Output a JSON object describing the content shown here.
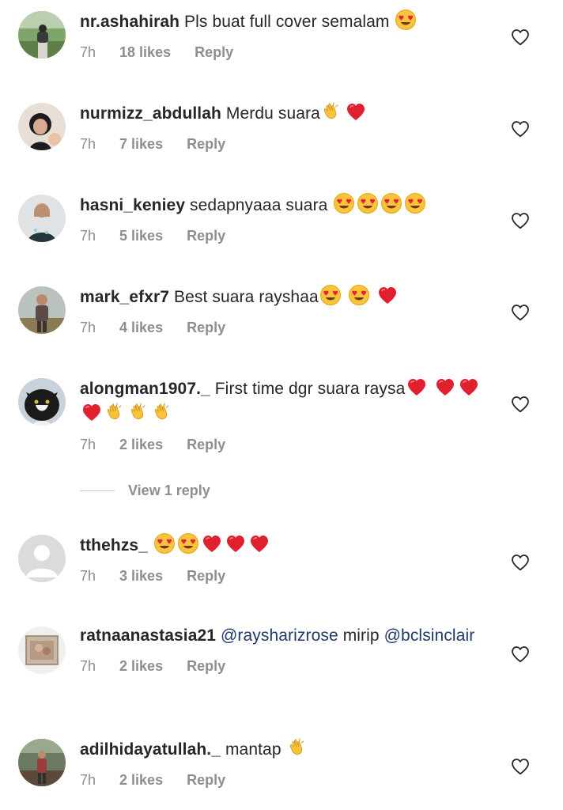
{
  "comments": [
    {
      "username": "nr.ashahirah",
      "text": "Pls buat full cover semalam",
      "time": "7h",
      "likes": "18 likes",
      "reply": "Reply",
      "emojis": [
        "heart-eyes"
      ]
    },
    {
      "username": "nurmizz_abdullah",
      "text": "Merdu suara",
      "time": "7h",
      "likes": "7 likes",
      "reply": "Reply",
      "emojis": [
        "clap",
        "red-heart"
      ]
    },
    {
      "username": "hasni_keniey",
      "text": "sedapnyaaa suara",
      "time": "7h",
      "likes": "5 likes",
      "reply": "Reply",
      "emojis": [
        "heart-eyes",
        "heart-eyes",
        "heart-eyes",
        "heart-eyes"
      ]
    },
    {
      "username": "mark_efxr7",
      "text": "Best suara rayshaa",
      "time": "7h",
      "likes": "4 likes",
      "reply": "Reply",
      "emojis": [
        "heart-eyes",
        "heart-eyes",
        "red-heart"
      ]
    },
    {
      "username": "alongman1907._",
      "text": "First time dgr suara raysa",
      "time": "7h",
      "likes": "2 likes",
      "reply": "Reply",
      "emojis": [
        "red-heart",
        "red-heart",
        "red-heart",
        "red-heart",
        "clap",
        "clap",
        "clap"
      ],
      "view_replies": "View 1 reply"
    },
    {
      "username": "tthehzs_",
      "text": "",
      "time": "7h",
      "likes": "3 likes",
      "reply": "Reply",
      "emojis": [
        "heart-eyes",
        "heart-eyes",
        "red-heart",
        "red-heart",
        "red-heart"
      ]
    },
    {
      "username": "ratnaanastasia21",
      "mention1": "@raysharizrose",
      "text": "mirip",
      "mention2": "@bclsinclair",
      "time": "7h",
      "likes": "2 likes",
      "reply": "Reply"
    },
    {
      "username": "adilhidayatullah._",
      "text": "mantap",
      "time": "7h",
      "likes": "2 likes",
      "reply": "Reply",
      "emojis": [
        "clap"
      ]
    }
  ],
  "icons": {
    "like": "heart-outline-icon",
    "heart_eyes": "heart-eyes-emoji",
    "red_heart": "red-heart-emoji",
    "clap": "clapping-hands-emoji"
  },
  "colors": {
    "text": "#262626",
    "meta": "#8e8e8e",
    "mention": "#1f3a68",
    "heart": "#e0202e",
    "emoji_face": "#f9c33a"
  }
}
